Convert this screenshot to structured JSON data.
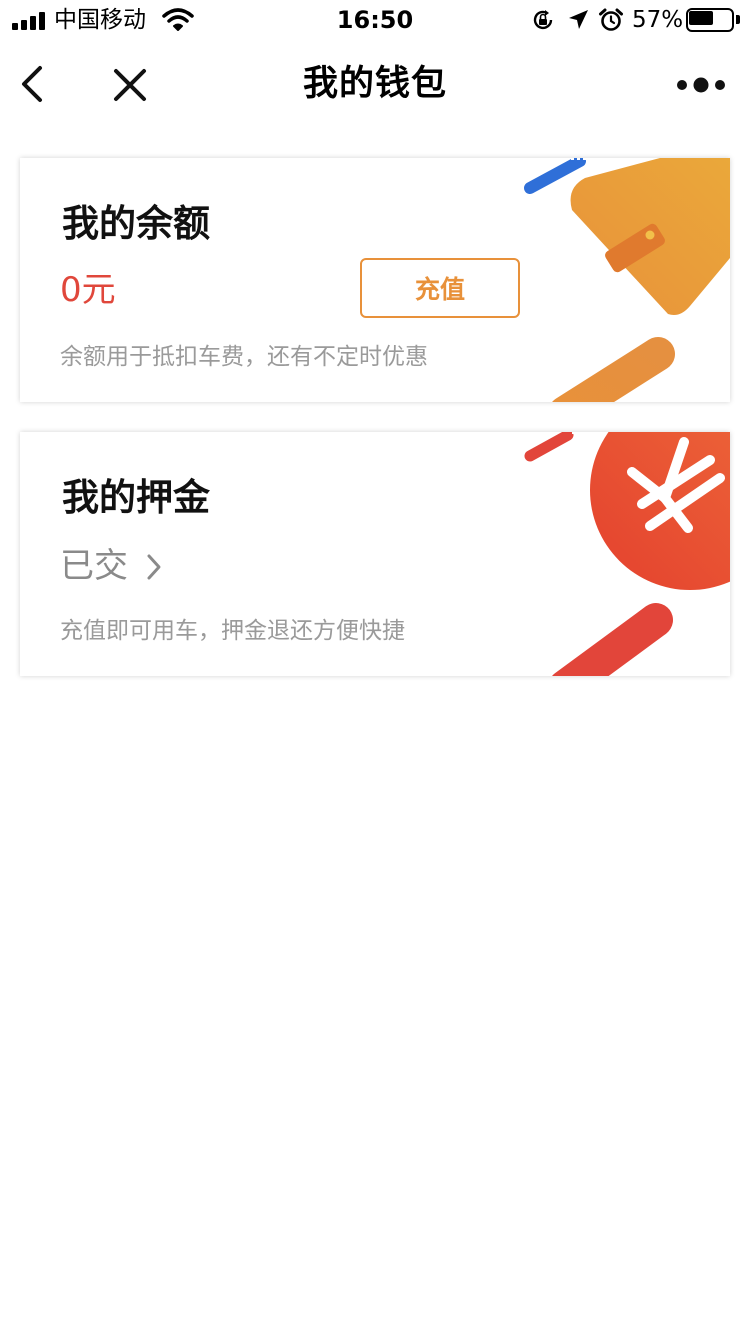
{
  "status_bar": {
    "carrier": "中国移动",
    "time": "16:50",
    "battery_percent": "57%",
    "battery_level": 0.57,
    "icons": [
      "signal-icon",
      "wifi-icon",
      "rotation-lock-icon",
      "location-icon",
      "alarm-icon",
      "battery-icon"
    ]
  },
  "nav": {
    "title": "我的钱包",
    "icons": [
      "back-icon",
      "close-icon",
      "more-icon"
    ]
  },
  "balance_card": {
    "title": "我的余额",
    "amount": "0元",
    "button_label": "充值",
    "description": "余额用于抵扣车费，还有不定时优惠"
  },
  "deposit_card": {
    "title": "我的押金",
    "status": "已交",
    "description": "充值即可用车，押金退还方便快捷"
  },
  "colors": {
    "accent_orange": "#e8913a",
    "amount_red": "#e0473b",
    "deco_blue": "#2f6fd8",
    "deco_red": "#e2453a"
  }
}
